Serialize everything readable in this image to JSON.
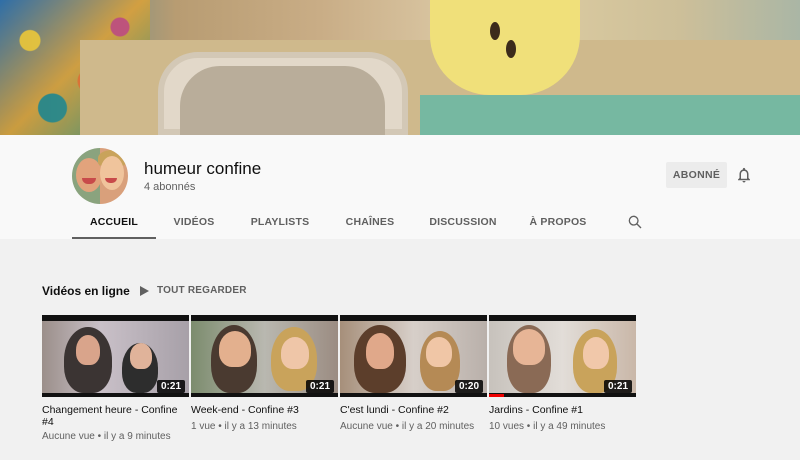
{
  "channel": {
    "name": "humeur confine",
    "subscribers": "4 abonnés",
    "subscribe_label": "ABONNÉ"
  },
  "tabs": [
    {
      "label": "ACCUEIL",
      "active": true
    },
    {
      "label": "VIDÉOS",
      "active": false
    },
    {
      "label": "PLAYLISTS",
      "active": false
    },
    {
      "label": "CHAÎNES",
      "active": false
    },
    {
      "label": "DISCUSSION",
      "active": false
    },
    {
      "label": "À PROPOS",
      "active": false
    }
  ],
  "shelf": {
    "title": "Vidéos en ligne",
    "play_all_label": "TOUT REGARDER"
  },
  "videos": [
    {
      "title": "Changement heure - Confine #4",
      "duration": "0:21",
      "views": "Aucune vue",
      "age": "il y a 9 minutes",
      "progress": 0
    },
    {
      "title": "Week-end - Confine #3",
      "duration": "0:21",
      "views": "1 vue",
      "age": "il y a 13 minutes",
      "progress": 0
    },
    {
      "title": "C'est lundi - Confine #2",
      "duration": "0:20",
      "views": "Aucune vue",
      "age": "il y a 20 minutes",
      "progress": 0
    },
    {
      "title": "Jardins - Confine #1",
      "duration": "0:21",
      "views": "10 vues",
      "age": "il y a 49 minutes",
      "progress": 0.1
    }
  ],
  "colors": {
    "accent": "#ff0000",
    "text_primary": "#0f0f0f",
    "text_secondary": "#606060",
    "page_bg": "#f1f1f1",
    "header_bg": "#f9f9f9"
  },
  "icons": [
    "bell-icon",
    "search-icon",
    "play-icon"
  ]
}
